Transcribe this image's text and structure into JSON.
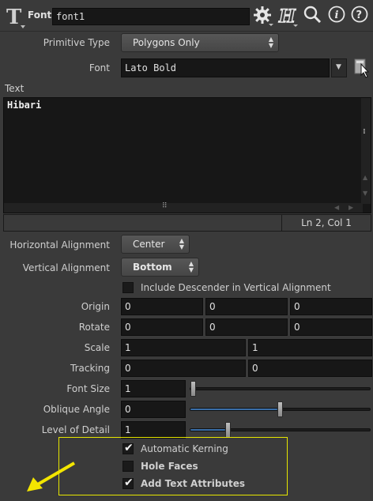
{
  "header": {
    "node_type": "Font",
    "node_name": "font1"
  },
  "params": {
    "primitive_type": {
      "label": "Primitive Type",
      "value": "Polygons Only"
    },
    "font": {
      "label": "Font",
      "value": "Lato Bold"
    },
    "text": {
      "label": "Text",
      "value": "Hibari",
      "status": "Ln 2, Col 1"
    },
    "horizontal_alignment": {
      "label": "Horizontal Alignment",
      "value": "Center"
    },
    "vertical_alignment": {
      "label": "Vertical Alignment",
      "value": "Bottom"
    },
    "include_descender": {
      "label": "Include Descender in Vertical Alignment",
      "checked": false
    },
    "origin": {
      "label": "Origin",
      "values": [
        "0",
        "0",
        "0"
      ]
    },
    "rotate": {
      "label": "Rotate",
      "values": [
        "0",
        "0",
        "0"
      ]
    },
    "scale": {
      "label": "Scale",
      "values": [
        "1",
        "1"
      ]
    },
    "tracking": {
      "label": "Tracking",
      "values": [
        "0",
        "0"
      ]
    },
    "font_size": {
      "label": "Font Size",
      "value": "1",
      "slider_fraction": 0.0
    },
    "oblique_angle": {
      "label": "Oblique Angle",
      "value": "0",
      "slider_fraction": 0.5
    },
    "level_of_detail": {
      "label": "Level of Detail",
      "value": "1",
      "slider_fraction": 0.2
    },
    "automatic_kerning": {
      "label": "Automatic Kerning",
      "checked": true
    },
    "hole_faces": {
      "label": "Hole Faces",
      "checked": false
    },
    "add_text_attributes": {
      "label": "Add Text Attributes",
      "checked": true
    }
  },
  "icons": [
    "font-node-icon",
    "gear-icon",
    "houdini-help-icon",
    "search-icon",
    "info-icon",
    "help-icon",
    "file-browse-icon",
    "dropdown-arrow-icon"
  ],
  "colors": {
    "highlight_box": "#e6e600",
    "arrow": "#f2e500",
    "slider_fill": "#3a6ea8"
  }
}
